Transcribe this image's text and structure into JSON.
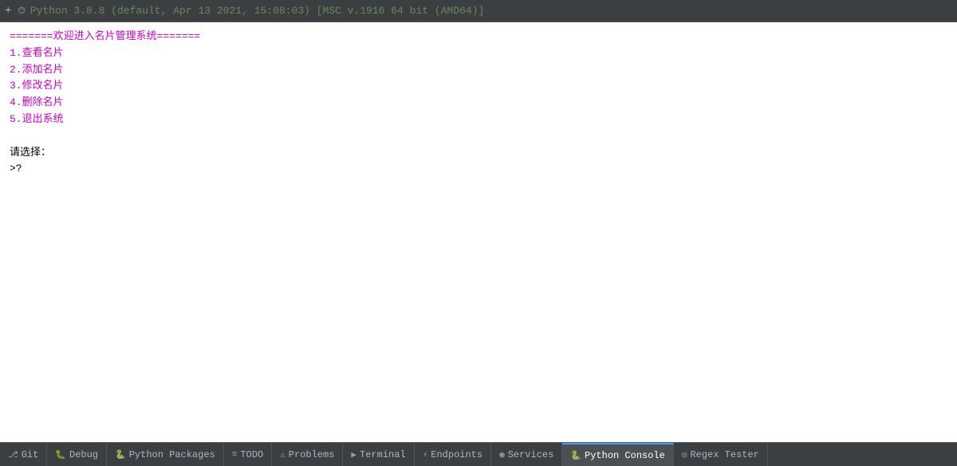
{
  "topbar": {
    "plus_label": "+",
    "clock_icon": "⏱",
    "python_version": "Python 3.8.8 (default, Apr 13 2021, 15:08:03) [MSC v.1916 64 bit (AMD64)]"
  },
  "console": {
    "lines": [
      {
        "type": "magenta",
        "text": "=======欢迎进入名片管理系统======="
      },
      {
        "type": "magenta",
        "text": "1.查看名片"
      },
      {
        "type": "magenta",
        "text": "2.添加名片"
      },
      {
        "type": "magenta",
        "text": "3.修改名片"
      },
      {
        "type": "magenta",
        "text": "4.删除名片"
      },
      {
        "type": "magenta",
        "text": "5.退出系统"
      },
      {
        "type": "empty",
        "text": ""
      },
      {
        "type": "black",
        "text": "请选择："
      },
      {
        "type": "prompt",
        "text": ">?"
      }
    ]
  },
  "bottom_tabs": [
    {
      "id": "git",
      "icon": "⎇",
      "label": "Git",
      "active": false
    },
    {
      "id": "debug",
      "icon": "🐛",
      "label": "Debug",
      "active": false
    },
    {
      "id": "python-packages",
      "icon": "🐍",
      "label": "Python Packages",
      "active": false
    },
    {
      "id": "todo",
      "icon": "≡",
      "label": "TODO",
      "active": false
    },
    {
      "id": "problems",
      "icon": "⚠",
      "label": "Problems",
      "active": false
    },
    {
      "id": "terminal",
      "icon": "▶",
      "label": "Terminal",
      "active": false
    },
    {
      "id": "endpoints",
      "icon": "⚡",
      "label": "Endpoints",
      "active": false
    },
    {
      "id": "services",
      "icon": "◉",
      "label": "Services",
      "active": false
    },
    {
      "id": "python-console",
      "icon": "🐍",
      "label": "Python Console",
      "active": true
    },
    {
      "id": "regex-tester",
      "icon": "◎",
      "label": "Regex Tester",
      "active": false
    }
  ]
}
